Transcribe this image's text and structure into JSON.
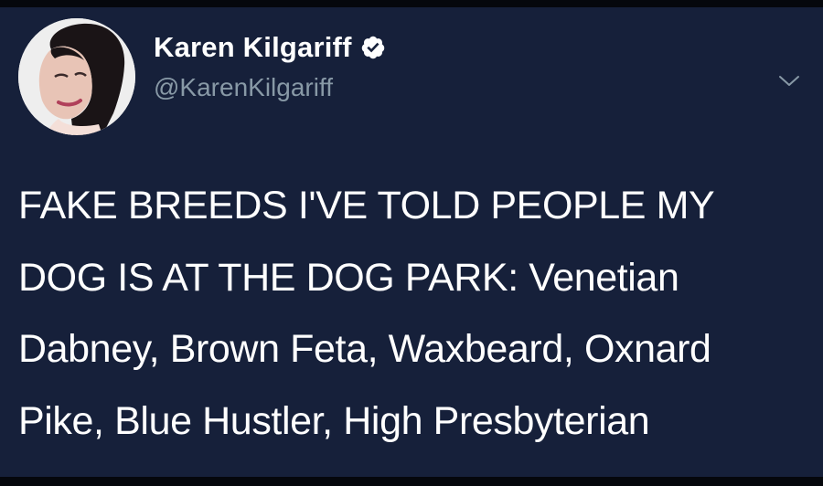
{
  "tweet": {
    "author": {
      "display_name": "Karen Kilgariff",
      "handle": "@KarenKilgariff",
      "verified": true
    },
    "text": "FAKE BREEDS I'VE TOLD PEOPLE MY\nDOG IS AT THE DOG PARK: Venetian\nDabney, Brown Feta, Waxbeard, Oxnard\nPike, Blue Hustler, High Presbyterian"
  },
  "colors": {
    "background": "#16203a",
    "text": "#ffffff",
    "handle": "#8899a6",
    "verified_badge": "#ffffff"
  },
  "icons": {
    "verified": "verified-badge-icon",
    "menu": "chevron-down-icon"
  }
}
